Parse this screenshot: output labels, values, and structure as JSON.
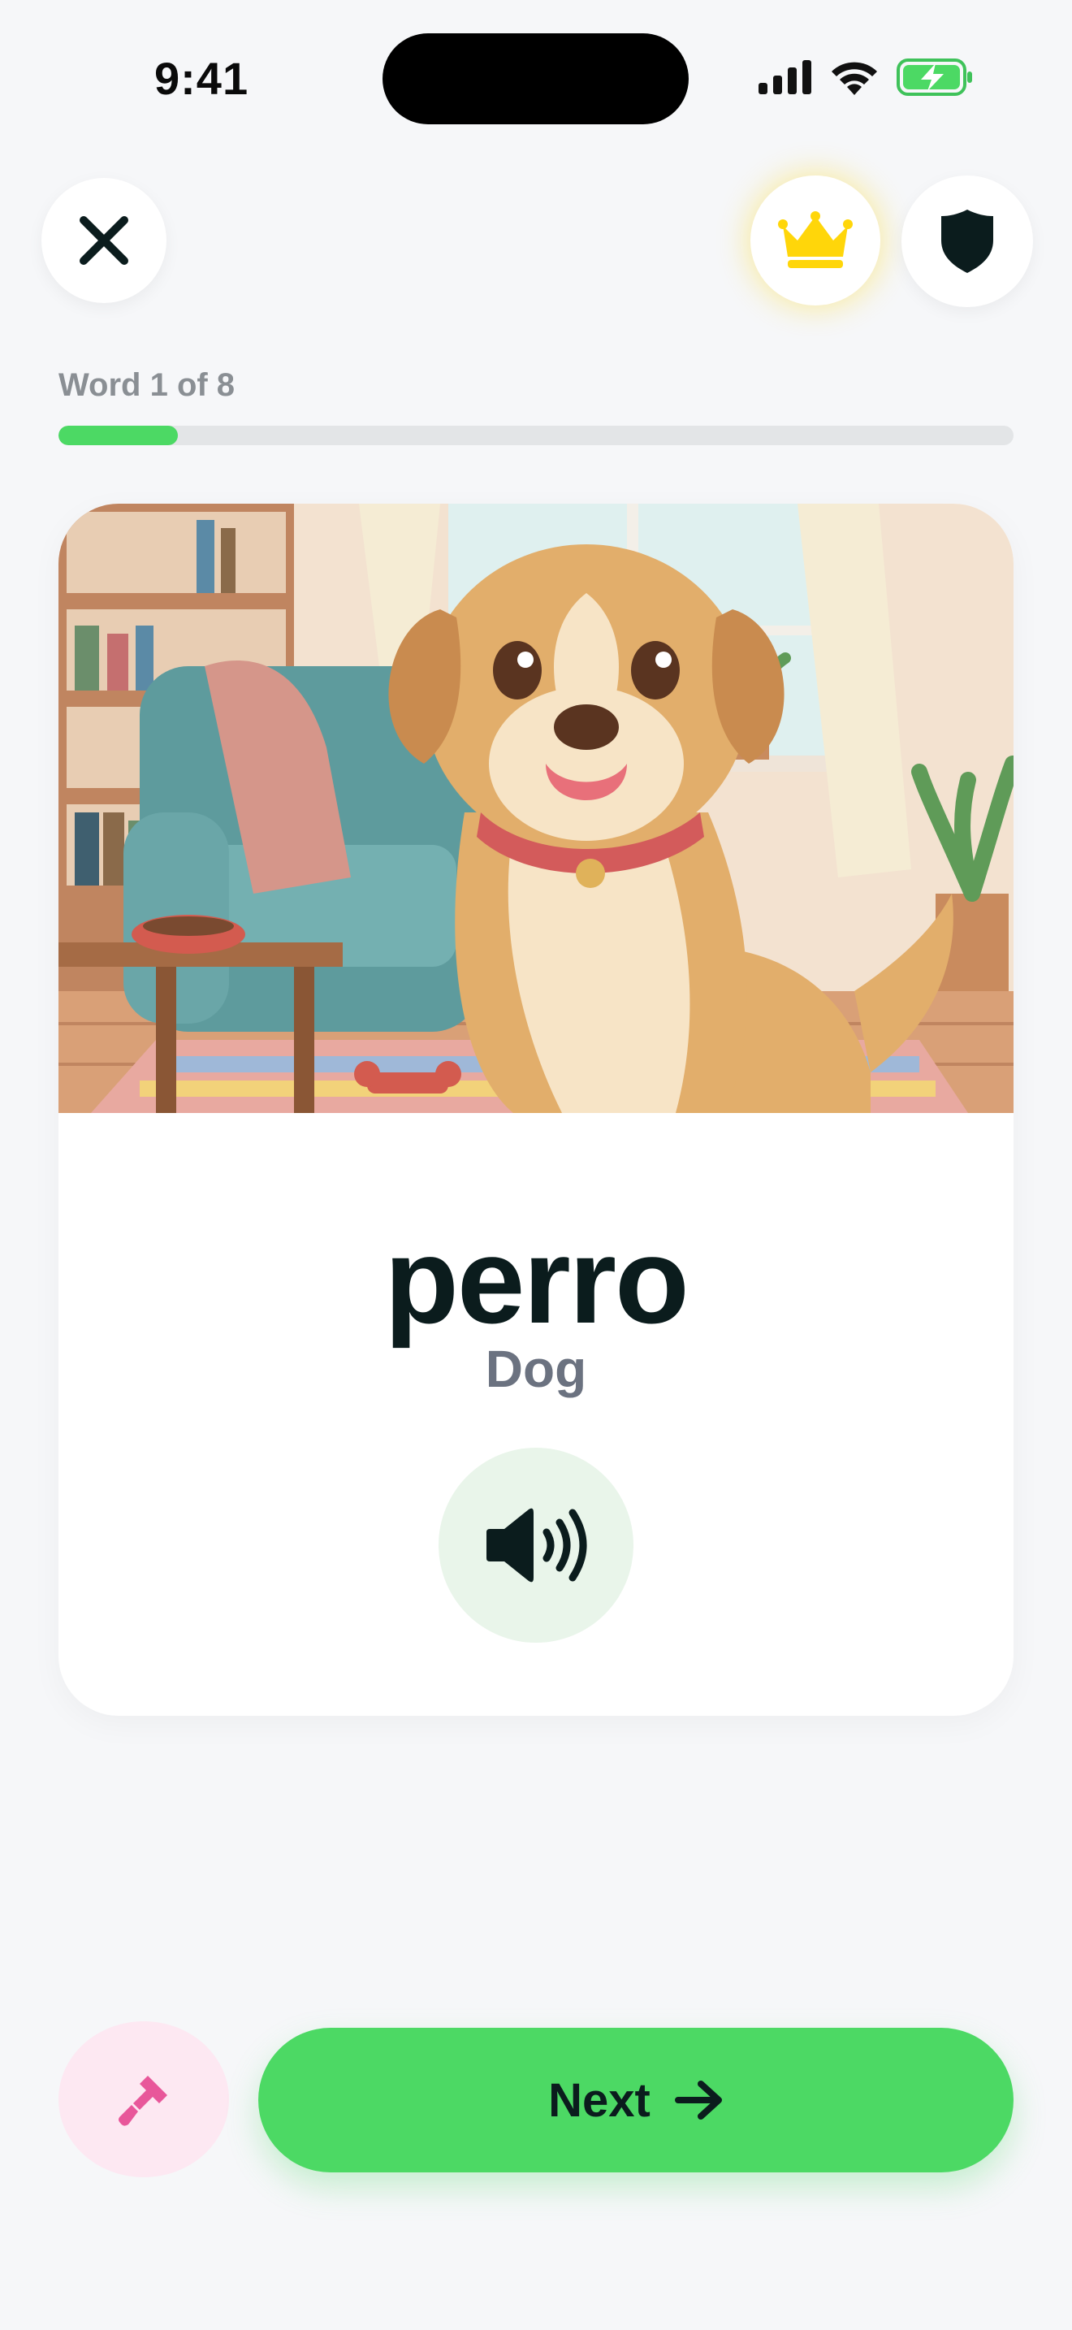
{
  "status_bar": {
    "time": "9:41"
  },
  "progress": {
    "label": "Word 1 of 8",
    "fraction": 0.125
  },
  "card": {
    "image_description_icon": "dog-illustration",
    "word": "perro",
    "translation": "Dog"
  },
  "actions": {
    "next_label": "Next"
  },
  "icons": {
    "close": "close-icon",
    "premium": "crown-icon",
    "shield": "shield-icon",
    "audio": "speaker-icon",
    "hint": "paintbrush-icon",
    "next": "arrow-right-icon"
  },
  "colors": {
    "accent_green": "#4cd964",
    "crown_yellow": "#ffd60a",
    "hint_pink": "#e8579a",
    "dark_text": "#0b1c1d"
  }
}
